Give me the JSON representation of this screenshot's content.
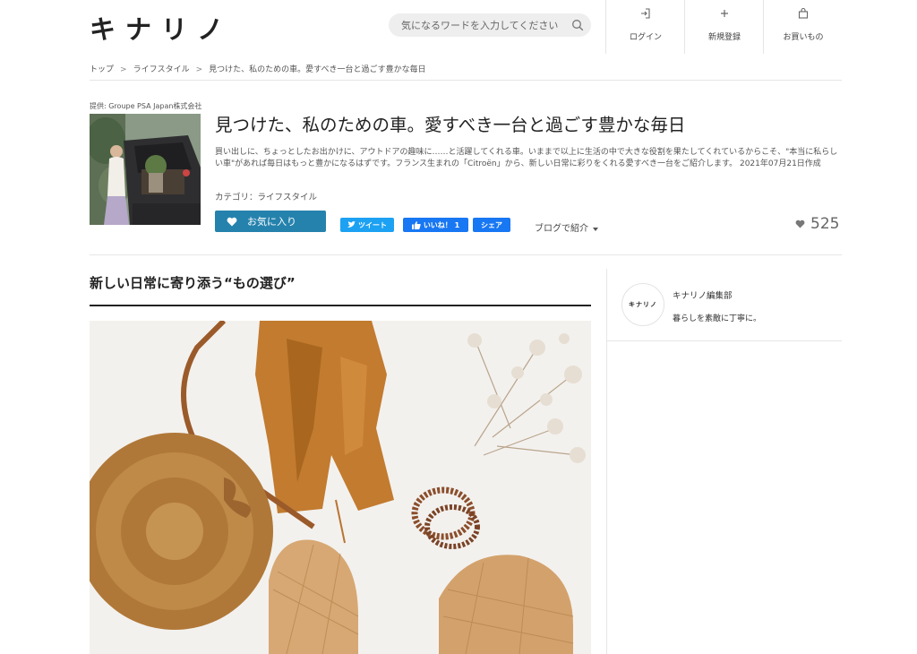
{
  "header": {
    "logo": "キナリノ",
    "search_placeholder": "気になるワードを入力してください",
    "nav": [
      {
        "label": "ログイン",
        "icon": "login-icon"
      },
      {
        "label": "新規登録",
        "icon": "plus-icon"
      },
      {
        "label": "お買いもの",
        "icon": "shopping-bag-icon"
      }
    ]
  },
  "breadcrumb": {
    "items": [
      "トップ",
      "ライフスタイル",
      "見つけた、私のための車。愛すべき一台と過ごす豊かな毎日"
    ],
    "separator": ">"
  },
  "article": {
    "sponsor": "提供: Groupe PSA Japan株式会社",
    "title": "見つけた、私のための車。愛すべき一台と過ごす豊かな毎日",
    "lead": "買い出しに、ちょっとしたお出かけに、アウトドアの趣味に……と活躍してくれる車。いままで以上に生活の中で大きな役割を果たしてくれているからこそ、\"本当に私らしい車\"があれば毎日はもっと豊かになるはずです。フランス生まれの「Citroën」から、新しい日常に彩りをくれる愛すべき一台をご紹介します。",
    "date": "2021年07月21日作成",
    "category": "カテゴリ：ライフスタイル",
    "favorite_label": "お気に入り",
    "share": {
      "tweet": "ツイート",
      "like": "いいね！ 1",
      "share": "シェア"
    },
    "blog_label": "ブログで紹介",
    "favorite_count": "525"
  },
  "section": {
    "heading": "新しい日常に寄り添う“もの選び”"
  },
  "author": {
    "avatar_text": "キナリノ",
    "name": "キナリノ編集部",
    "tagline": "暮らしを素敵に丁寧に。"
  },
  "colors": {
    "accent": "#2582ad",
    "twitter": "#1da1f2",
    "facebook": "#1877f2"
  }
}
